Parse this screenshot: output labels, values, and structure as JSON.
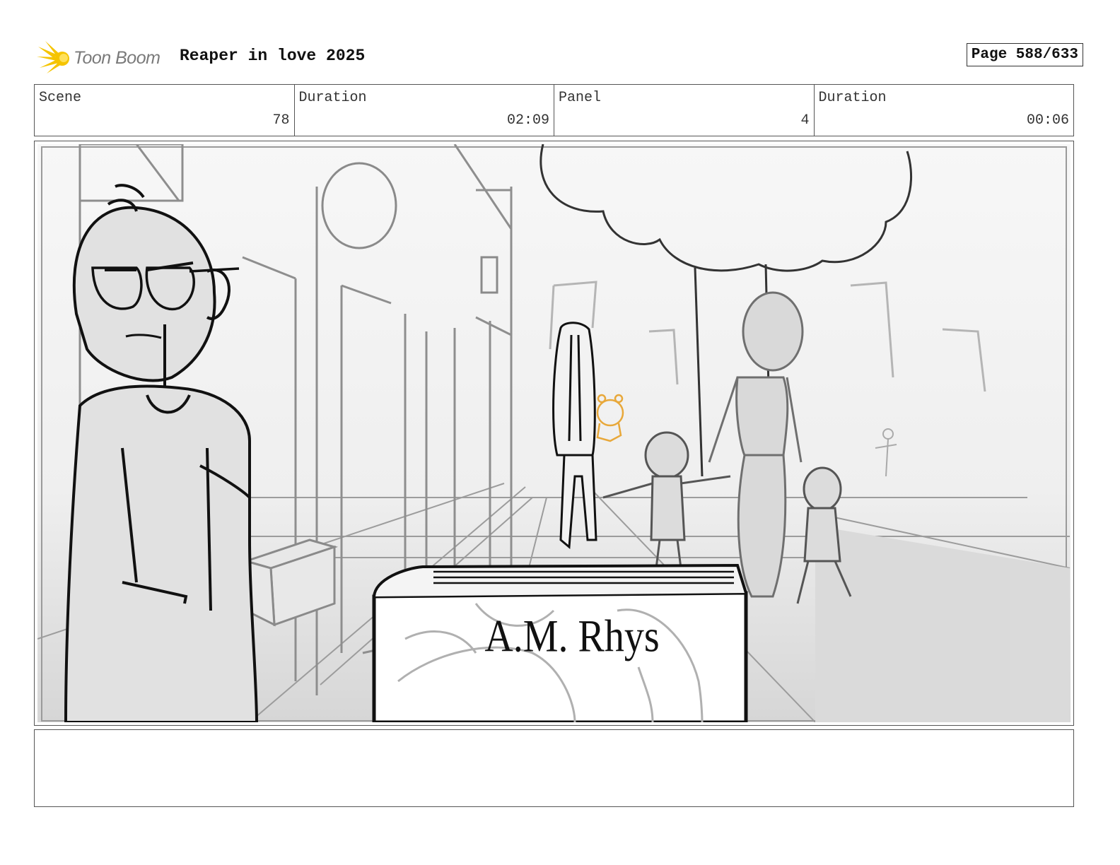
{
  "header": {
    "logo_text": "Toon Boom",
    "project_title": "Reaper in love 2025",
    "page_label": "Page 588/633"
  },
  "info": {
    "scene_label": "Scene",
    "scene_value": "78",
    "scene_duration_label": "Duration",
    "scene_duration_value": "02:09",
    "panel_label": "Panel",
    "panel_value": "4",
    "panel_duration_label": "Duration",
    "panel_duration_value": "00:06"
  },
  "panel": {
    "book_title": "A.M. Rhys"
  },
  "notes": {
    "text": ""
  },
  "colors": {
    "logo_accent": "#f5c400",
    "sketch_line": "#111111",
    "sketch_gray": "#8a8a8a",
    "doodle_orange": "#e8a83a"
  }
}
